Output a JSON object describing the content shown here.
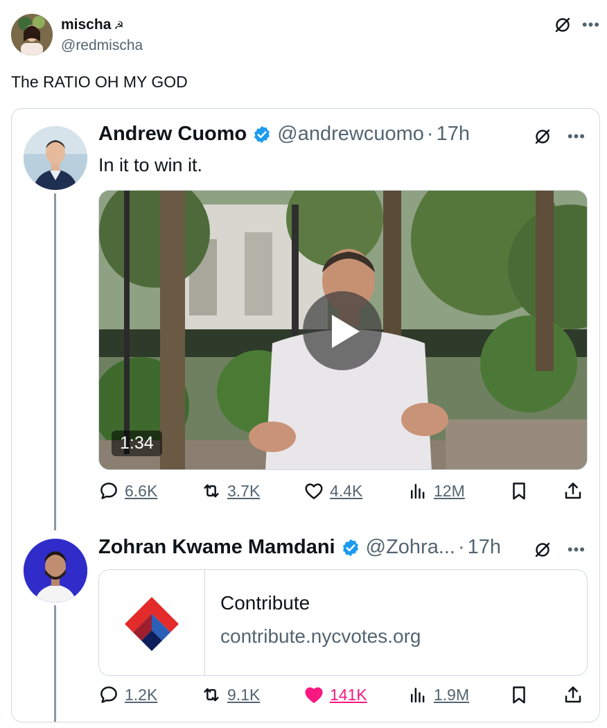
{
  "post": {
    "author_name": "mischa",
    "author_emoji": "☭",
    "author_handle": "@redmischa",
    "text": "The RATIO OH MY GOD"
  },
  "thread": [
    {
      "name": "Andrew Cuomo",
      "handle": "@andrewcuomo",
      "dot": "·",
      "time": "17h",
      "text": "In it to win it.",
      "video_duration": "1:34",
      "stats": {
        "replies": "6.6K",
        "reposts": "3.7K",
        "likes": "4.4K",
        "views": "12M"
      }
    },
    {
      "name": "Zohran Kwame Mamdani",
      "handle": "@Zohra...",
      "dot": "·",
      "time": "17h",
      "link_card": {
        "title": "Contribute",
        "url": "contribute.nycvotes.org"
      },
      "stats": {
        "replies": "1.2K",
        "reposts": "9.1K",
        "likes": "141K",
        "views": "1.9M"
      }
    }
  ],
  "icons": {
    "grok": "grok-icon",
    "more": "more-icon",
    "verified": "verified-badge-icon",
    "reply": "reply-icon",
    "repost": "repost-icon",
    "like": "heart-icon",
    "views": "views-icon",
    "bookmark": "bookmark-icon",
    "share": "share-icon"
  },
  "colors": {
    "text": "#0f1419",
    "secondary": "#536471",
    "border": "#cfd9de",
    "verified": "#1d9bf0",
    "like_active": "#f91880",
    "thread_line": "#8b98a5"
  }
}
